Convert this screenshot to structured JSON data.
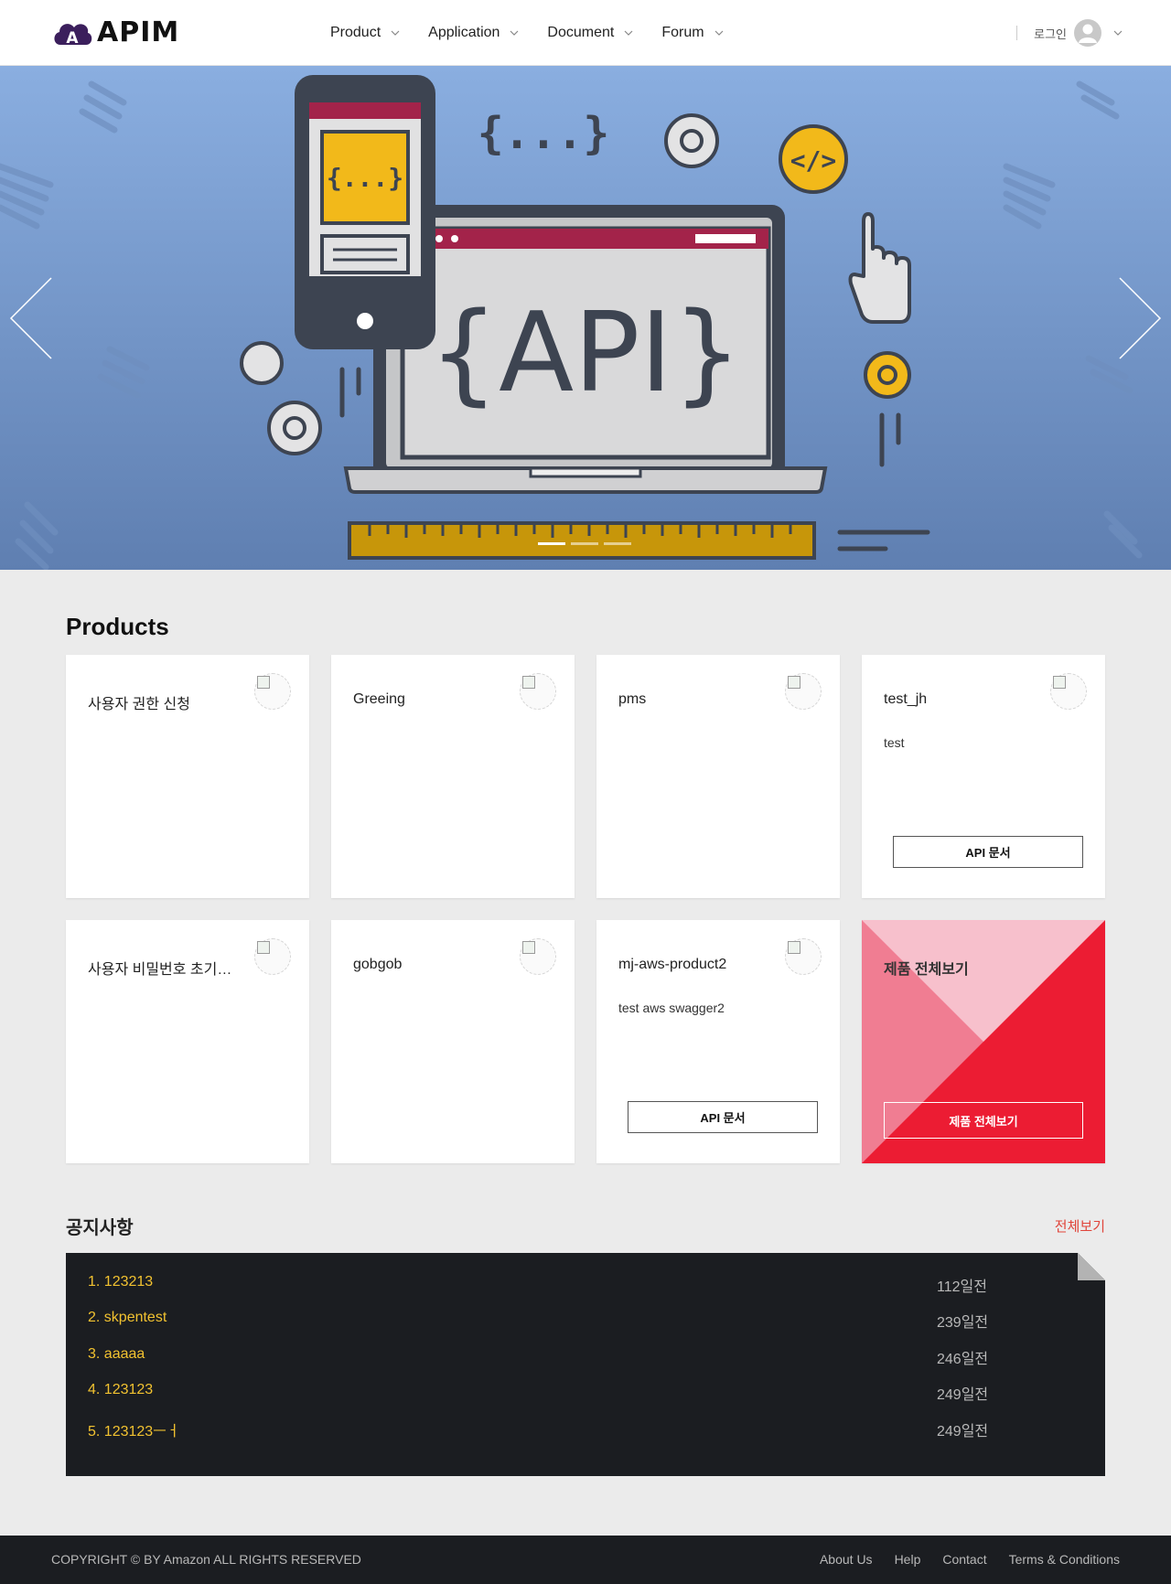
{
  "brand": {
    "name": "APIM",
    "logo_letter": "A",
    "accent": "#3b1f5c"
  },
  "nav": {
    "items": [
      {
        "label": "Product"
      },
      {
        "label": "Application"
      },
      {
        "label": "Document"
      },
      {
        "label": "Forum"
      }
    ]
  },
  "user": {
    "login_label": "로그인"
  },
  "hero": {
    "art_text": "{API}",
    "phone_text": "{...}",
    "braces_text": "{...}",
    "code_badge": "</>",
    "slides_count": 3,
    "active_slide": 1
  },
  "products": {
    "title": "Products",
    "cards": [
      {
        "title": "사용자 권한 신청",
        "desc": "",
        "button": ""
      },
      {
        "title": "Greeing",
        "desc": "",
        "button": ""
      },
      {
        "title": "pms",
        "desc": "",
        "button": ""
      },
      {
        "title": "test_jh",
        "desc": "test",
        "button": "API 문서"
      },
      {
        "title": "사용자 비밀번호 초기화 ...",
        "desc": "",
        "button": ""
      },
      {
        "title": "gobgob",
        "desc": "",
        "button": ""
      },
      {
        "title": "mj-aws-product2",
        "desc": "test aws swagger2",
        "button": "API 문서"
      }
    ],
    "view_all": {
      "title": "제품 전체보기",
      "button": "제품 전체보기"
    }
  },
  "notice": {
    "title": "공지사항",
    "more": "전체보기",
    "items": [
      {
        "title": "1. 123213",
        "date": "112일전"
      },
      {
        "title": "2. skpentest",
        "date": "239일전"
      },
      {
        "title": "3. aaaaa",
        "date": "246일전"
      },
      {
        "title": "4. 123123",
        "date": "249일전"
      },
      {
        "title": "5. 123123ㅡㅓ",
        "date": "249일전"
      }
    ]
  },
  "footer": {
    "copyright": "COPYRIGHT © BY Amazon ALL RIGHTS RESERVED",
    "links": [
      "About Us",
      "Help",
      "Contact",
      "Terms & Conditions"
    ]
  }
}
